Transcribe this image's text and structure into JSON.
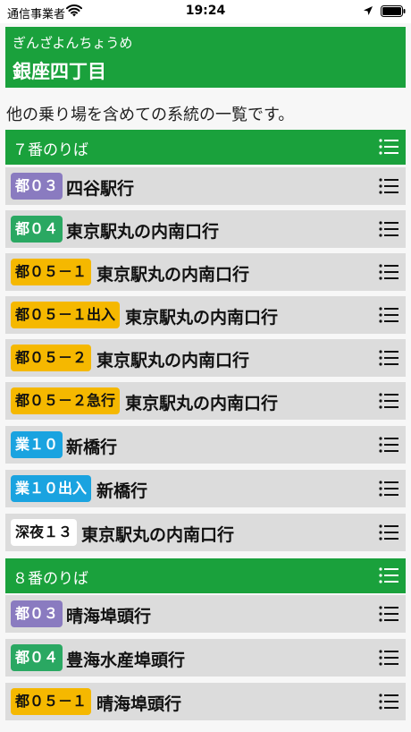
{
  "status_bar": {
    "carrier": "通信事業者",
    "time": "19:24"
  },
  "stop": {
    "reading": "ぎんざよんちょうめ",
    "name": "銀座四丁目"
  },
  "note": "他の乗り場を含めての系統の一覧です。",
  "colors": {
    "header_green": "#1aa13c",
    "to03": "#8a7bc0",
    "to04": "#2aa862",
    "to05": "#f5b800",
    "gyo10": "#1aa3e0",
    "shinya": "#ffffff"
  },
  "platforms": [
    {
      "label": "７番のりば",
      "routes": [
        {
          "badge": "都０３",
          "dest": "四谷駅行"
        },
        {
          "badge": "都０４",
          "dest": "東京駅丸の内南口行"
        },
        {
          "badge": "都０５－１",
          "dest": "東京駅丸の内南口行"
        },
        {
          "badge": "都０５－１出入",
          "dest": "東京駅丸の内南口行"
        },
        {
          "badge": "都０５－２",
          "dest": "東京駅丸の内南口行"
        },
        {
          "badge": "都０５－２急行",
          "dest": "東京駅丸の内南口行"
        },
        {
          "badge": "業１０",
          "dest": "新橋行"
        },
        {
          "badge": "業１０出入",
          "dest": "新橋行"
        },
        {
          "badge": "深夜１３",
          "dest": "東京駅丸の内南口行"
        }
      ]
    },
    {
      "label": "８番のりば",
      "routes": [
        {
          "badge": "都０３",
          "dest": "晴海埠頭行"
        },
        {
          "badge": "都０４",
          "dest": "豊海水産埠頭行"
        },
        {
          "badge": "都０５－１",
          "dest": "晴海埠頭行"
        }
      ]
    }
  ],
  "icons": {
    "list": "list-icon",
    "wifi": "wifi-icon",
    "location": "location-arrow-icon",
    "battery": "battery-icon"
  }
}
